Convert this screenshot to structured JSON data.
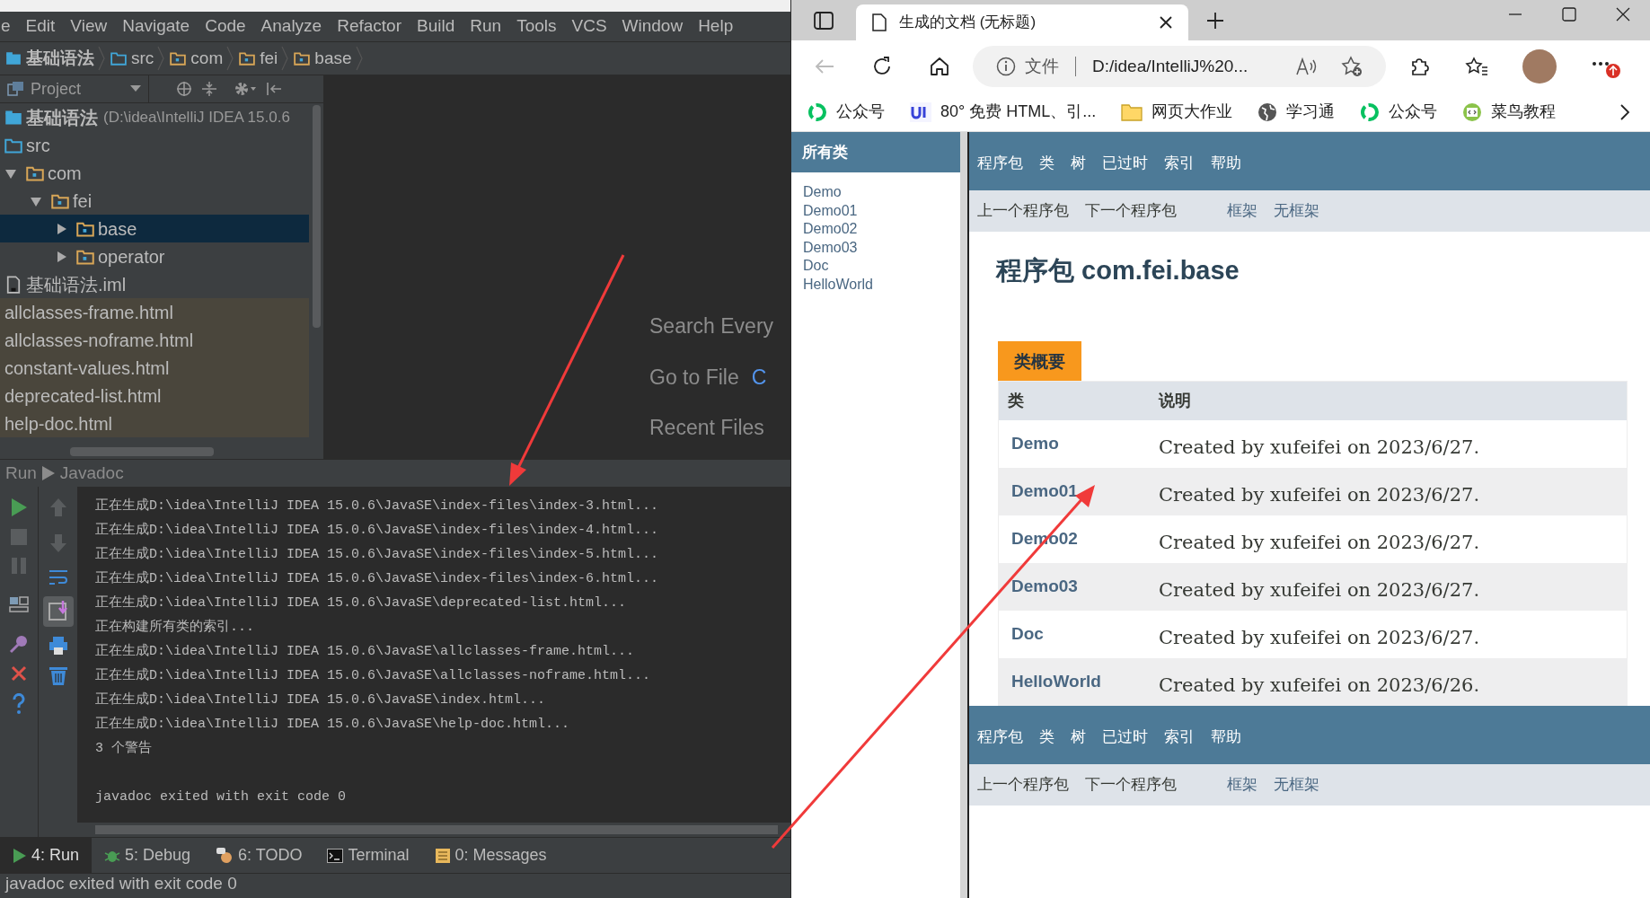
{
  "ide": {
    "menu": [
      "e",
      "Edit",
      "View",
      "Navigate",
      "Code",
      "Analyze",
      "Refactor",
      "Build",
      "Run",
      "Tools",
      "VCS",
      "Window",
      "Help"
    ],
    "breadcrumb": [
      {
        "label": "基础语法",
        "kind": "module"
      },
      {
        "label": "src",
        "kind": "source"
      },
      {
        "label": "com",
        "kind": "package"
      },
      {
        "label": "fei",
        "kind": "package"
      },
      {
        "label": "base",
        "kind": "package"
      }
    ],
    "project_panel": {
      "title": "Project",
      "tree": [
        {
          "label": "基础语法",
          "detail": "(D:\\idea\\IntelliJ IDEA 15.0.6",
          "kind": "module",
          "selected": false
        },
        {
          "label": "src",
          "kind": "source",
          "selected": false
        },
        {
          "label": "com",
          "kind": "package",
          "selected": false,
          "expanded": true,
          "children": [
            {
              "label": "fei",
              "kind": "package",
              "selected": false,
              "expanded": true,
              "children": [
                {
                  "label": "base",
                  "kind": "package",
                  "selected": true,
                  "expanded": false
                },
                {
                  "label": "operator",
                  "kind": "package",
                  "selected": false,
                  "expanded": false
                }
              ]
            }
          ]
        },
        {
          "label": "基础语法.iml",
          "kind": "file",
          "selected": false
        },
        {
          "label": "allclasses-frame.html",
          "kind": "generated",
          "selected": false
        },
        {
          "label": "allclasses-noframe.html",
          "kind": "generated",
          "selected": false
        },
        {
          "label": "constant-values.html",
          "kind": "generated",
          "selected": false
        },
        {
          "label": "deprecated-list.html",
          "kind": "generated",
          "selected": false
        },
        {
          "label": "help-doc.html",
          "kind": "generated",
          "selected": false
        }
      ]
    },
    "editor_hints": [
      {
        "label": "Search Every"
      },
      {
        "label": "Go to File",
        "shortcut": "C"
      },
      {
        "label": "Recent Files"
      }
    ],
    "run_panel": {
      "title": "Run",
      "config": "Javadoc",
      "lines": [
        "正在生成D:\\idea\\IntelliJ IDEA 15.0.6\\JavaSE\\index-files\\index-3.html...",
        "正在生成D:\\idea\\IntelliJ IDEA 15.0.6\\JavaSE\\index-files\\index-4.html...",
        "正在生成D:\\idea\\IntelliJ IDEA 15.0.6\\JavaSE\\index-files\\index-5.html...",
        "正在生成D:\\idea\\IntelliJ IDEA 15.0.6\\JavaSE\\index-files\\index-6.html...",
        "正在生成D:\\idea\\IntelliJ IDEA 15.0.6\\JavaSE\\deprecated-list.html...",
        "正在构建所有类的索引...",
        "正在生成D:\\idea\\IntelliJ IDEA 15.0.6\\JavaSE\\allclasses-frame.html...",
        "正在生成D:\\idea\\IntelliJ IDEA 15.0.6\\JavaSE\\allclasses-noframe.html...",
        "正在生成D:\\idea\\IntelliJ IDEA 15.0.6\\JavaSE\\index.html...",
        "正在生成D:\\idea\\IntelliJ IDEA 15.0.6\\JavaSE\\help-doc.html...",
        "3 个警告"
      ],
      "exit_message": "javadoc exited with exit code 0"
    },
    "tool_tabs": [
      {
        "label": "4: Run",
        "kind": "run",
        "selected": true
      },
      {
        "label": "5: Debug",
        "kind": "debug",
        "selected": false
      },
      {
        "label": "6: TODO",
        "kind": "todo",
        "selected": false
      },
      {
        "label": "Terminal",
        "kind": "terminal",
        "selected": false
      },
      {
        "label": "0: Messages",
        "kind": "messages",
        "selected": false
      }
    ],
    "status_bar": "javadoc exited with exit code 0"
  },
  "browser": {
    "tab": {
      "title": "生成的文档 (无标题)"
    },
    "address": {
      "scheme": "文件",
      "url": "D:/idea/IntelliJ%20..."
    },
    "bookmarks": [
      {
        "label": "公众号",
        "kind": "ring"
      },
      {
        "label": "80° 免费 HTML、引...",
        "kind": "ui"
      },
      {
        "label": "网页大作业",
        "kind": "folder"
      },
      {
        "label": "学习通",
        "kind": "globe"
      },
      {
        "label": "公众号",
        "kind": "ring"
      },
      {
        "label": "菜鸟教程",
        "kind": "code"
      }
    ],
    "javadoc": {
      "all_classes": {
        "title": "所有类",
        "items": [
          "Demo",
          "Demo01",
          "Demo02",
          "Demo03",
          "Doc",
          "HelloWorld"
        ]
      },
      "nav": [
        "程序包",
        "类",
        "树",
        "已过时",
        "索引",
        "帮助"
      ],
      "subnav": [
        {
          "label": "上一个程序包",
          "kind": "text"
        },
        {
          "label": "下一个程序包",
          "kind": "text"
        },
        {
          "label": "框架",
          "kind": "link"
        },
        {
          "label": "无框架",
          "kind": "link"
        }
      ],
      "title": "程序包 com.fei.base",
      "caption": "类概要",
      "columns": [
        "类",
        "说明"
      ],
      "rows": [
        {
          "name": "Demo",
          "description": "Created by xufeifei on 2023/6/27."
        },
        {
          "name": "Demo01",
          "description": "Created by xufeifei on 2023/6/27."
        },
        {
          "name": "Demo02",
          "description": "Created by xufeifei on 2023/6/27."
        },
        {
          "name": "Demo03",
          "description": "Created by xufeifei on 2023/6/27."
        },
        {
          "name": "Doc",
          "description": "Created by xufeifei on 2023/6/27."
        },
        {
          "name": "HelloWorld",
          "description": "Created by xufeifei on 2023/6/26."
        }
      ],
      "bottom_nav": [
        "程序包",
        "类",
        "树",
        "已过时",
        "索引",
        "帮助"
      ],
      "bottom_subnav": [
        {
          "label": "上一个程序包",
          "kind": "text"
        },
        {
          "label": "下一个程序包",
          "kind": "text"
        },
        {
          "label": "框架",
          "kind": "link"
        },
        {
          "label": "无框架",
          "kind": "link"
        }
      ]
    }
  }
}
